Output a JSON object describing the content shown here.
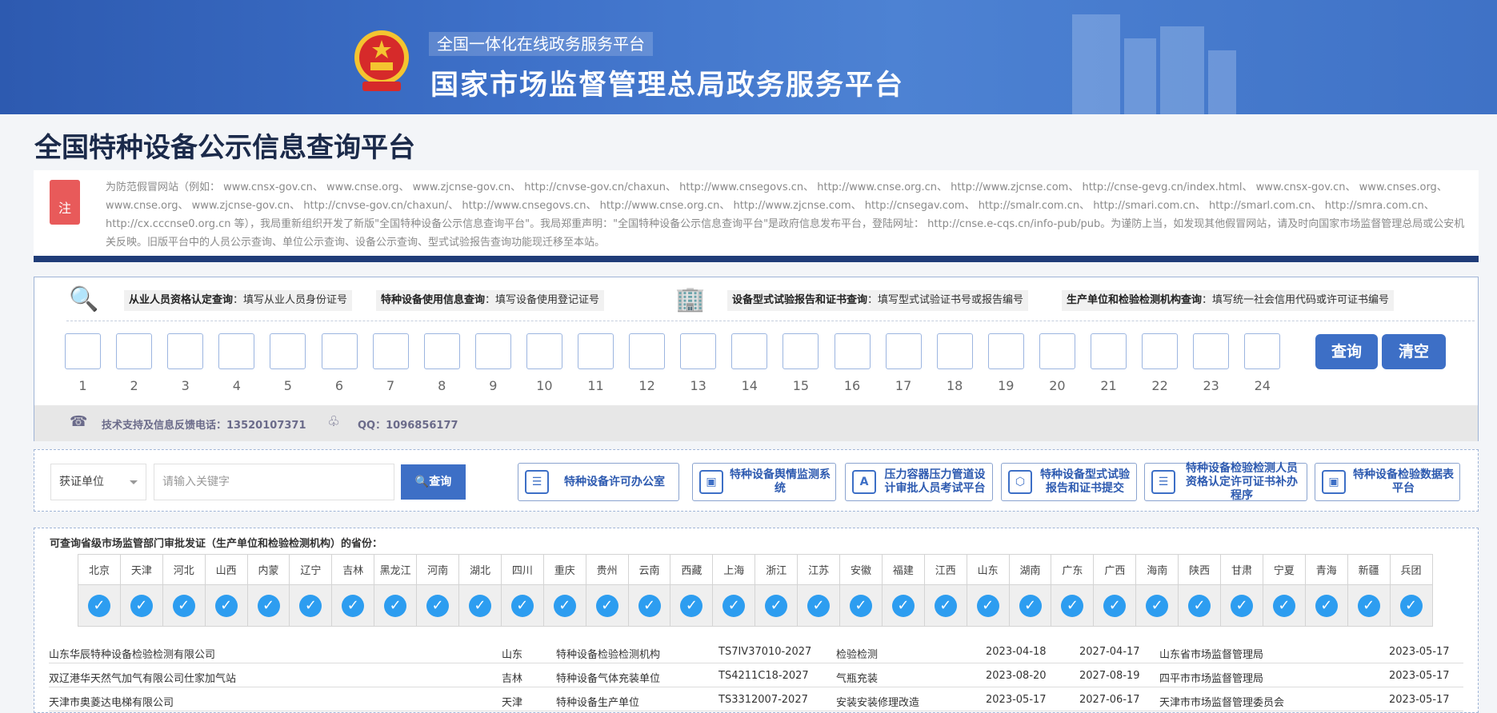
{
  "header": {
    "subtitle": "全国一体化在线政务服务平台",
    "title": "国家市场监督管理总局政务服务平台"
  },
  "platform_title": "全国特种设备公示信息查询平台",
  "notice": {
    "badge": "注",
    "text": "为防范假冒网站（例如： www.cnsx-gov.cn、 www.cnse.org、 www.zjcnse-gov.cn、 http://cnvse-gov.cn/chaxun、 http://www.cnsegovs.cn、 http://www.cnse.org.cn、 http://www.zjcnse.com、 http://cnse-gevg.cn/index.html、 www.cnsx-gov.cn、 www.cnses.org、 www.cnse.org、 www.zjcnse-gov.cn、 http://cnvse-gov.cn/chaxun/、 http://www.cnsegovs.cn、 http://www.cnse.org.cn、 http://www.zjcnse.com、 http://cnsegav.com、 http://smalr.com.cn、 http://smari.com.cn、 http://smarl.com.cn、 http://smra.com.cn、 http://cx.cccnse0.org.cn 等），我局重新组织开发了新版\"全国特种设备公示信息查询平台\"。我局郑重声明：\"全国特种设备公示信息查询平台\"是政府信息发布平台，登陆网址： http://cnse.e-cqs.cn/info-pub/pub。为谨防上当，如发现其他假冒网站，请及时向国家市场监督管理总局或公安机关反映。旧版平台中的人员公示查询、单位公示查询、设备公示查询、型式试验报告查询功能现迁移至本站。"
  },
  "query": {
    "hints": [
      {
        "title": "从业人员资格认定查询",
        "desc": "：填写从业人员身份证号"
      },
      {
        "title": "特种设备使用信息查询",
        "desc": "：填写设备使用登记证号"
      },
      {
        "title": "设备型式试验报告和证书查询",
        "desc": "：填写型式试验证书号或报告编号"
      },
      {
        "title": "生产单位和检验检测机构查询",
        "desc": "：填写统一社会信用代码或许可证书编号"
      }
    ],
    "cell_numbers": [
      "1",
      "2",
      "3",
      "4",
      "5",
      "6",
      "7",
      "8",
      "9",
      "10",
      "11",
      "12",
      "13",
      "14",
      "15",
      "16",
      "17",
      "18",
      "19",
      "20",
      "21",
      "22",
      "23",
      "24"
    ],
    "query_button": "查询",
    "clear_button": "清空",
    "support_phone": "技术支持及信息反馈电话：13520107371",
    "support_qq": "QQ：1096856177"
  },
  "tools": {
    "select_value": "获证单位",
    "keyword_placeholder": "请输入关键字",
    "search_button": "查询",
    "links": [
      "特种设备许可办公室",
      "特种设备舆情监测系统",
      "压力容器压力管道设计审批人员考试平台",
      "特种设备型式试验报告和证书提交",
      "特种设备检验检测人员资格认定许可证书补办程序",
      "特种设备检验数据表平台"
    ]
  },
  "provinces": {
    "caption": "可查询省级市场监管部门审批发证（生产单位和检验检测机构）的省份：",
    "names": [
      "北京",
      "天津",
      "河北",
      "山西",
      "内蒙",
      "辽宁",
      "吉林",
      "黑龙江",
      "河南",
      "湖北",
      "四川",
      "重庆",
      "贵州",
      "云南",
      "西藏",
      "上海",
      "浙江",
      "江苏",
      "安徽",
      "福建",
      "江西",
      "山东",
      "湖南",
      "广东",
      "广西",
      "海南",
      "陕西",
      "甘肃",
      "宁夏",
      "青海",
      "新疆",
      "兵团"
    ]
  },
  "records": [
    {
      "name": "山东华辰特种设备检验检测有限公司",
      "province": "山东",
      "type": "特种设备检验检测机构",
      "cert": "TS7IV37010-2027",
      "scope": "检验检测",
      "issue": "2023-04-18",
      "expire": "2027-04-17",
      "authority": "山东省市场监督管理局",
      "publish": "2023-05-17"
    },
    {
      "name": "双辽港华天然气加气有限公司仕家加气站",
      "province": "吉林",
      "type": "特种设备气体充装单位",
      "cert": "TS4211C18-2027",
      "scope": "气瓶充装",
      "issue": "2023-08-20",
      "expire": "2027-08-19",
      "authority": "四平市市场监督管理局",
      "publish": "2023-05-17"
    },
    {
      "name": "天津市奥菱达电梯有限公司",
      "province": "天津",
      "type": "特种设备生产单位",
      "cert": "TS3312007-2027",
      "scope": "安装安装修理改造",
      "issue": "2023-05-17",
      "expire": "2027-06-17",
      "authority": "天津市市场监督管理委员会",
      "publish": "2023-05-17"
    }
  ]
}
